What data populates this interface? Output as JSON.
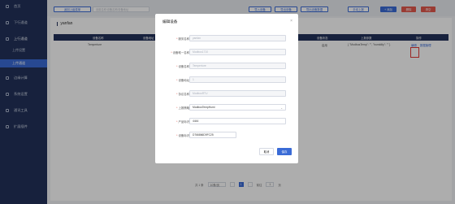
{
  "sidebar": {
    "items": [
      {
        "label": "首页"
      },
      {
        "label": "下行通道"
      },
      {
        "label": "上行通道"
      },
      {
        "label": "边缘计算"
      },
      {
        "label": "系统设置"
      },
      {
        "label": "通讯工具"
      },
      {
        "label": "扩展插件"
      }
    ],
    "subitems": [
      {
        "label": "上传设置"
      },
      {
        "label": "上传通道"
      }
    ]
  },
  "toolbar": {
    "back_label": "返回上级菜单",
    "search_placeholder": "设置名称/设备名称/设备地址",
    "import_label": "导入设备",
    "export_label": "导出设备",
    "export_data_label": "导出设备数据",
    "manual_add_label": "手动上报",
    "add_label": "+ 添加",
    "delete_label": "删除",
    "clear_label": "清空"
  },
  "panel": {
    "title": "yanfan"
  },
  "table": {
    "headers": [
      "设备名称",
      "设备地址",
      "设备状态",
      "上报参数",
      "操作"
    ],
    "row": {
      "name": "Temperture",
      "status": "启用",
      "params": "{ \"ModbusTemp\": \"\", \"humidity\": \"\" }",
      "edit": "编辑",
      "more": "数据管理"
    }
  },
  "pagination": {
    "total": "共 1 条",
    "page_size": "10条/页",
    "current": "1",
    "goto_label": "前往",
    "goto_value": "1",
    "page_suffix": "页"
  },
  "modal": {
    "title": "编辑设备",
    "close": "×",
    "fields": [
      {
        "label": "服务名称",
        "required": true,
        "value": "yanfan"
      },
      {
        "label": "设备唯一名称",
        "required": true,
        "value": "Modbus1710"
      },
      {
        "label": "设备名称",
        "required": true,
        "value": "Temperture"
      },
      {
        "label": "设备地址",
        "required": true,
        "value": "1"
      },
      {
        "label": "协议名称",
        "required": true,
        "value": "ModbusRTU"
      },
      {
        "label": "上报策略",
        "required": true,
        "value": "ModbusTempHumi"
      },
      {
        "label": "产品标识",
        "required": true,
        "value": "4444"
      },
      {
        "label": "设备标识",
        "required": true,
        "value": "D766866D9FC25"
      }
    ],
    "cancel_label": "取消",
    "save_label": "保存"
  }
}
